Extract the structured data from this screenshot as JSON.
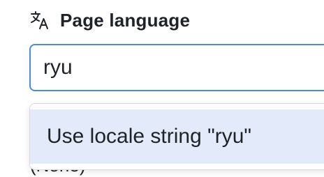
{
  "header": {
    "icon": "translate-icon",
    "title": "Page language"
  },
  "input": {
    "value": "ryu"
  },
  "dropdown": {
    "options": [
      {
        "label": "Use locale string \"ryu\"",
        "highlighted": true
      }
    ],
    "behind_option": "(None)"
  },
  "colors": {
    "accent": "#4c8ae0",
    "highlight": "#e3ebfa",
    "text": "#1f2328"
  }
}
